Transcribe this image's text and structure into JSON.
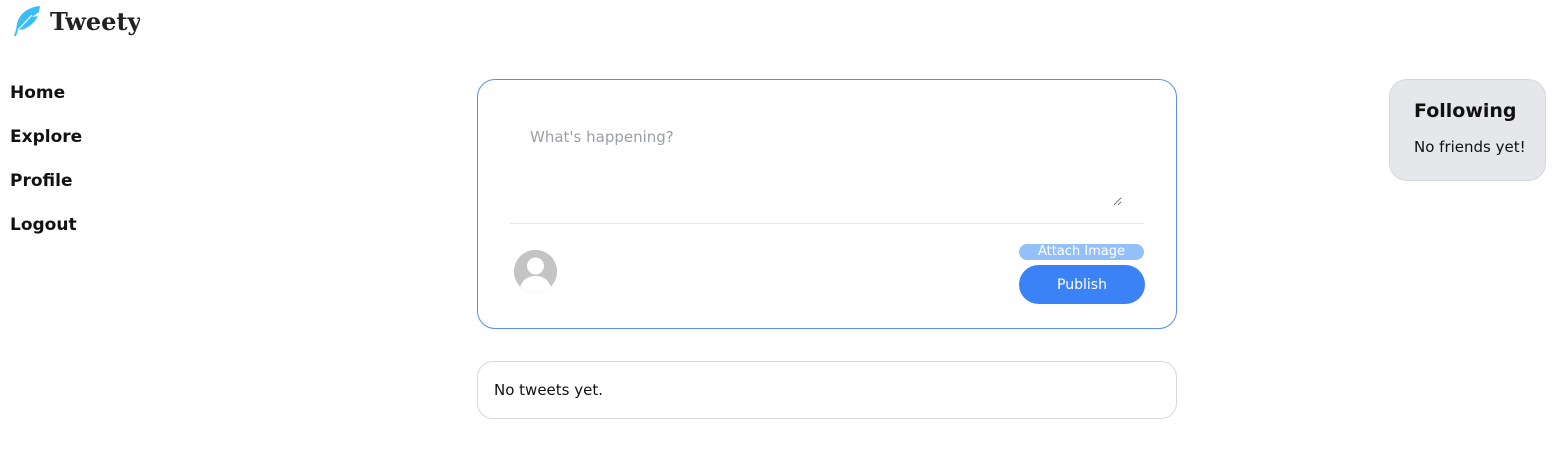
{
  "app": {
    "name": "Tweety",
    "logo_icon": "feather-icon",
    "logo_color": "#38bdf8"
  },
  "sidebar": {
    "items": [
      {
        "label": "Home"
      },
      {
        "label": "Explore"
      },
      {
        "label": "Profile"
      },
      {
        "label": "Logout"
      }
    ]
  },
  "composer": {
    "placeholder": "What's happening?",
    "value": "",
    "avatar_icon": "default-avatar-icon",
    "attach_label": "Attach Image",
    "publish_label": "Publish",
    "accent": "#3b82f6"
  },
  "feed": {
    "empty_text": "No tweets yet."
  },
  "following": {
    "title": "Following",
    "empty_text": "No friends yet!"
  }
}
